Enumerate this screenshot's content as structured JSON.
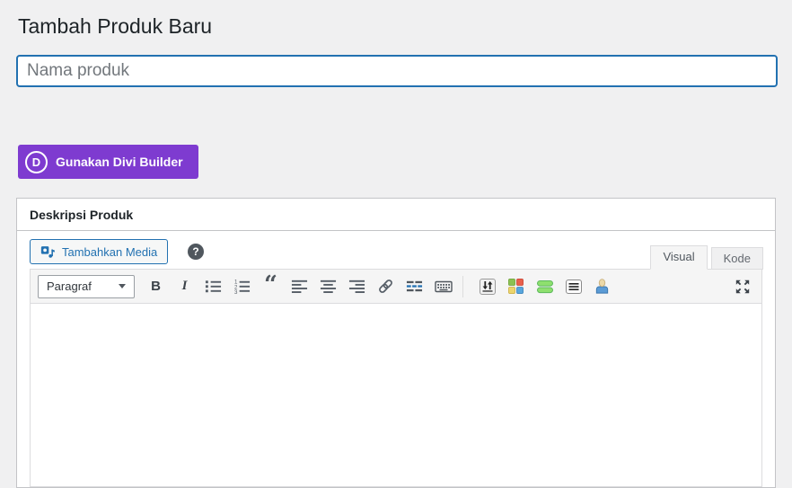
{
  "page_title": "Tambah Produk Baru",
  "title_field": {
    "placeholder": "Nama produk",
    "value": ""
  },
  "divi": {
    "button_label": "Gunakan Divi Builder",
    "logo_letter": "D"
  },
  "description_panel": {
    "heading": "Deskripsi Produk",
    "add_media_button": "Tambahkan Media",
    "help_glyph": "?",
    "tabs": {
      "visual": "Visual",
      "code": "Kode"
    },
    "toolbar": {
      "format_select": "Paragraf",
      "bold_glyph": "B",
      "italic_glyph": "I",
      "blockquote_glyph": "“",
      "icons": [
        "bulleted-list-icon",
        "numbered-list-icon",
        "blockquote-icon",
        "align-left-icon",
        "align-center-icon",
        "align-right-icon",
        "link-icon",
        "read-more-icon",
        "keyboard-icon",
        "sort-arrows-page-icon",
        "colored-blocks-icon",
        "green-bars-icon",
        "text-lines-page-icon",
        "user-icon",
        "fullscreen-icon"
      ]
    },
    "content": ""
  },
  "colors": {
    "accent_blue": "#2271b1",
    "divi_purple": "#7e3bd0",
    "page_background": "#f0f0f1",
    "panel_border": "#c3c4c7",
    "toolbar_background": "#f5f5f5",
    "icon_gray": "#555d66"
  }
}
